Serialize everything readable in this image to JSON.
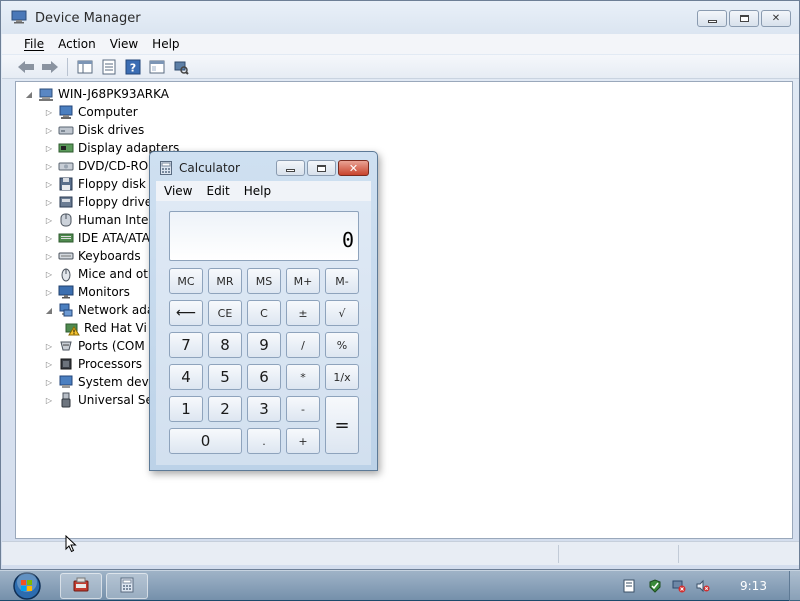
{
  "device_manager": {
    "title": "Device Manager",
    "menu": [
      "File",
      "Action",
      "View",
      "Help"
    ],
    "toolbar_icons": [
      "back-arrow-icon",
      "forward-arrow-icon",
      "show-hide-console-tree-icon",
      "properties-icon",
      "help-icon",
      "console-icon",
      "scan-hardware-icon"
    ],
    "tree": {
      "root": "WIN-J68PK93ARKA",
      "nodes": [
        {
          "label": "Computer",
          "icon": "computer-icon",
          "expanded": false
        },
        {
          "label": "Disk drives",
          "icon": "disk-drive-icon",
          "expanded": false
        },
        {
          "label": "Display adapters",
          "icon": "display-adapter-icon",
          "expanded": false
        },
        {
          "label": "DVD/CD-ROM",
          "icon": "dvd-drive-icon",
          "expanded": false
        },
        {
          "label": "Floppy disk dr",
          "icon": "floppy-disk-icon",
          "expanded": false
        },
        {
          "label": "Floppy drive c",
          "icon": "floppy-controller-icon",
          "expanded": false
        },
        {
          "label": "Human Interfa",
          "icon": "hid-icon",
          "expanded": false
        },
        {
          "label": "IDE ATA/ATAP",
          "icon": "ide-controller-icon",
          "expanded": false
        },
        {
          "label": "Keyboards",
          "icon": "keyboard-icon",
          "expanded": false
        },
        {
          "label": "Mice and othe",
          "icon": "mouse-icon",
          "expanded": false
        },
        {
          "label": "Monitors",
          "icon": "monitor-icon",
          "expanded": false
        },
        {
          "label": "Network adap",
          "icon": "network-adapter-icon",
          "expanded": true
        },
        {
          "label": "Red Hat Vi",
          "icon": "warning-device-icon",
          "child": true
        },
        {
          "label": "Ports (COM &",
          "icon": "port-icon",
          "expanded": false
        },
        {
          "label": "Processors",
          "icon": "processor-icon",
          "expanded": false
        },
        {
          "label": "System device",
          "icon": "system-device-icon",
          "expanded": false
        },
        {
          "label": "Universal Seria",
          "icon": "usb-icon",
          "expanded": false
        }
      ]
    }
  },
  "calculator": {
    "title": "Calculator",
    "menu": [
      "View",
      "Edit",
      "Help"
    ],
    "display": "0",
    "keys": {
      "mc": "MC",
      "mr": "MR",
      "ms": "MS",
      "mplus": "M+",
      "mminus": "M-",
      "backspace": "⟵",
      "ce": "CE",
      "c": "C",
      "negate": "±",
      "sqrt": "√",
      "k7": "7",
      "k8": "8",
      "k9": "9",
      "divide": "/",
      "percent": "%",
      "k4": "4",
      "k5": "5",
      "k6": "6",
      "multiply": "*",
      "reciprocal": "1/x",
      "k1": "1",
      "k2": "2",
      "k3": "3",
      "subtract": "-",
      "equals": "=",
      "k0": "0",
      "decimal": ".",
      "add": "+"
    }
  },
  "taskbar": {
    "clock": "9:13",
    "buttons": [
      "device-manager-taskbar-icon",
      "calculator-taskbar-icon"
    ],
    "tray_icons": [
      "action-center-icon",
      "network-icon",
      "speaker-muted-icon"
    ]
  },
  "colors": {
    "close_button": "#c8432c",
    "taskbar": "#8aa2ba",
    "window_frame": "#d3dded"
  }
}
